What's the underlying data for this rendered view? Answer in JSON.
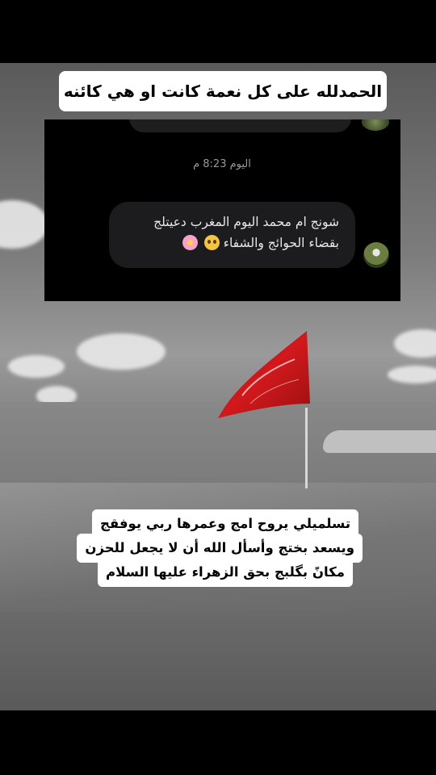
{
  "caption_top": "الحمدلله على كل نعمة كانت او هي كائنه",
  "chat": {
    "timestamp": "اليوم 8:23 م",
    "message_line1": "شونج ام محمد اليوم المغرب دعيتلج",
    "message_line2": "بقضاء الحوائج والشفاء",
    "emoji_1": "pleading-face-emoji",
    "emoji_2": "cherry-blossom-emoji"
  },
  "caption_bottom": {
    "line1": "تسلميلي يروح امج وعمرها ربي يوفقج",
    "line2": "ويسعد بختج وأسأل الله أن لا يجعل للحزن",
    "line3": "مكانً بگلبج بحق الزهراء عليها السلام"
  },
  "colors": {
    "flag": "#c0171a",
    "bubble": "#1c1c1e",
    "chat_bg": "#000000"
  }
}
